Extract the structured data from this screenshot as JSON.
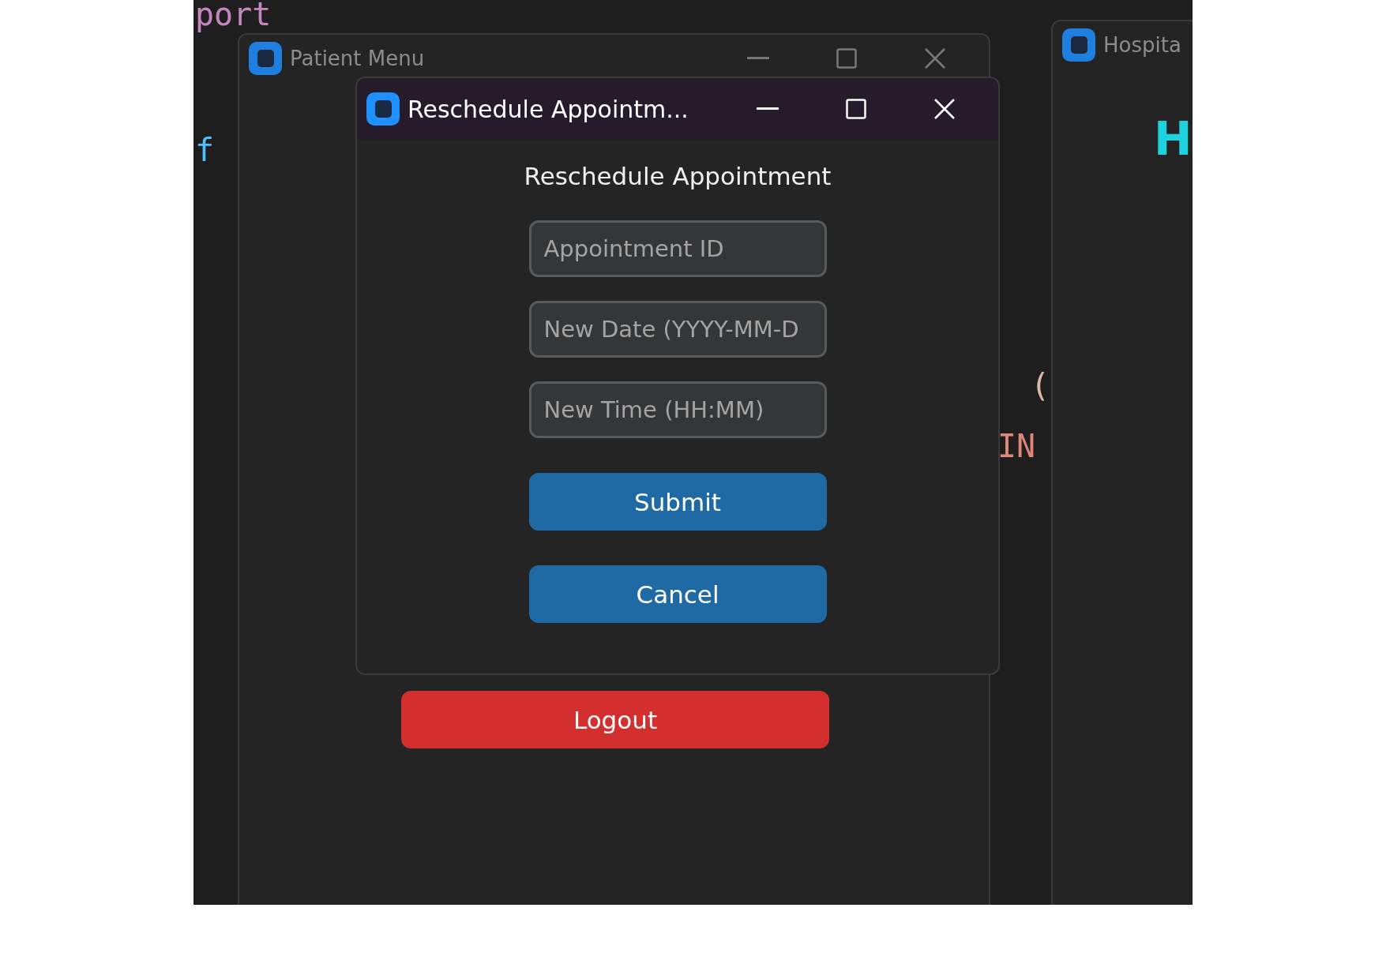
{
  "editor": {
    "fragments": [
      {
        "text": "port",
        "kind": "keyword"
      },
      {
        "text": "f",
        "kind": "name"
      },
      {
        "text": "(",
        "kind": "paren"
      },
      {
        "text": "IN",
        "kind": "string"
      }
    ]
  },
  "patient_window": {
    "title": "Patient Menu",
    "logout_button": "Logout"
  },
  "dialog": {
    "title": "Reschedule Appointm...",
    "heading": "Reschedule Appointment",
    "fields": [
      {
        "placeholder": "Appointment ID"
      },
      {
        "placeholder": "New Date (YYYY-MM-D"
      },
      {
        "placeholder": "New Time (HH:MM)"
      }
    ],
    "buttons": [
      "Submit",
      "Cancel"
    ]
  },
  "hospital_window": {
    "title": "Hospita",
    "heading": "H"
  }
}
